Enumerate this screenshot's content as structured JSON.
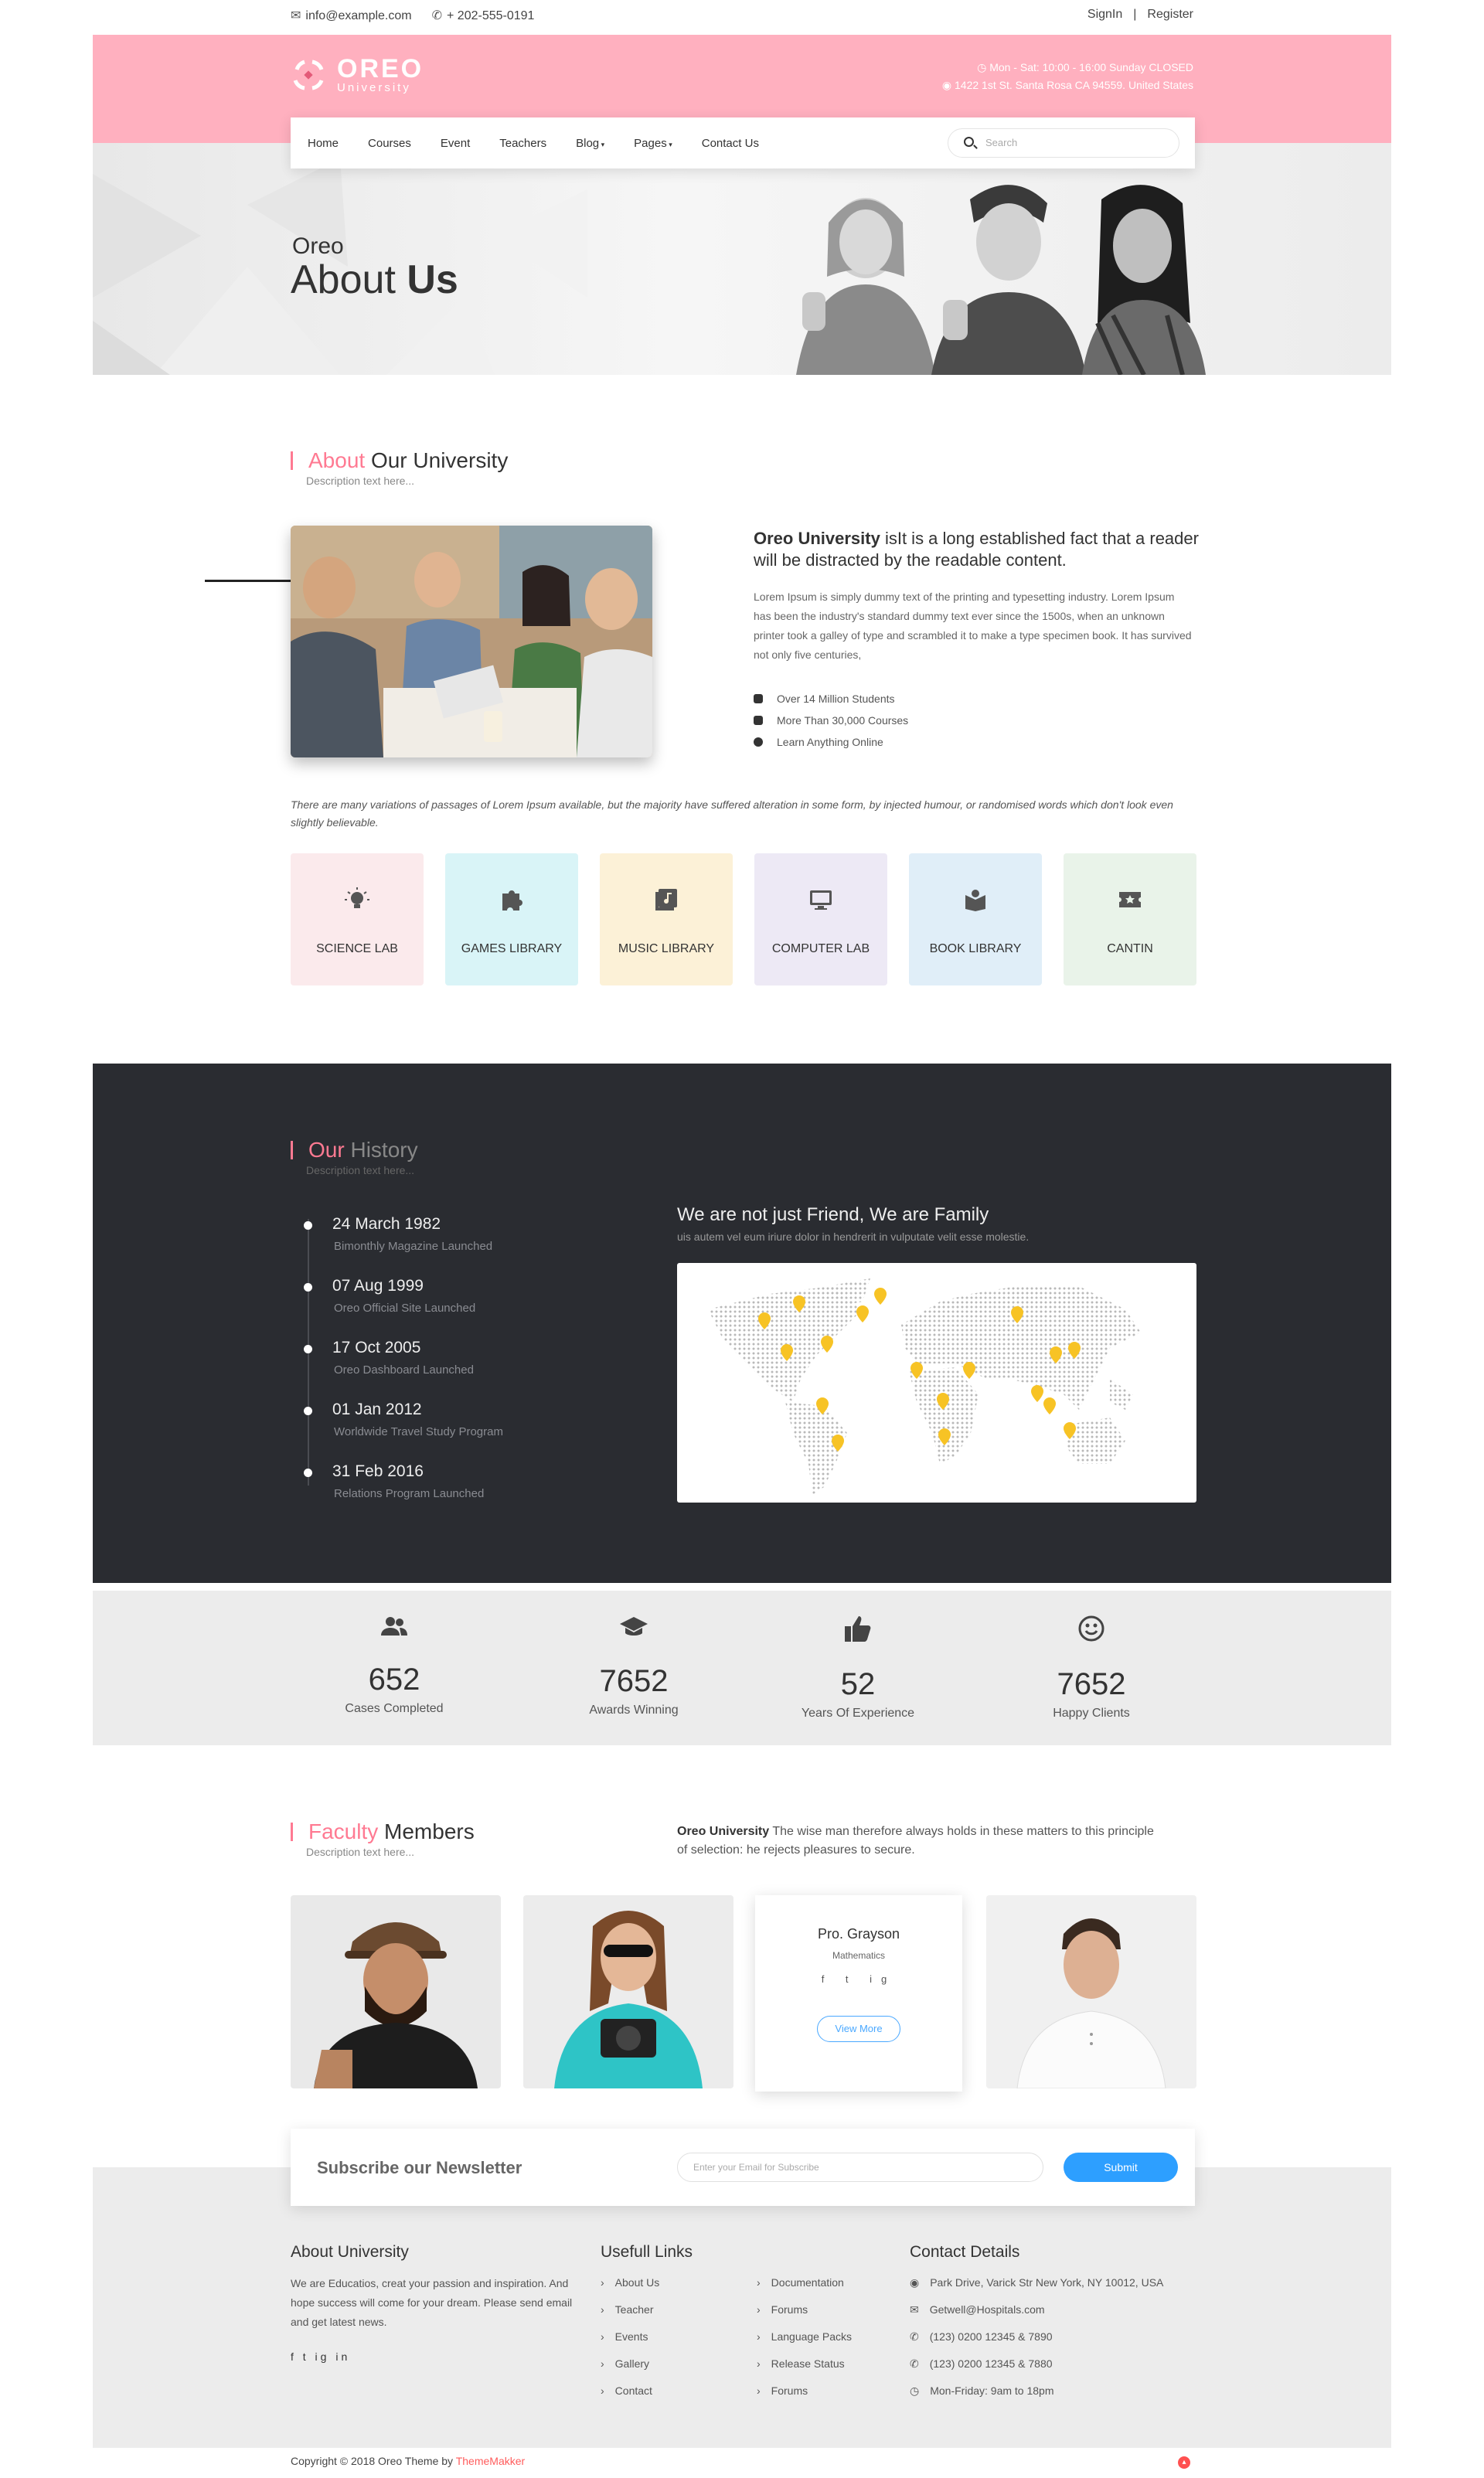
{
  "topbar": {
    "email": "info@example.com",
    "phone": "+ 202-555-0191",
    "signin": "SignIn",
    "separator": "|",
    "register": "Register"
  },
  "brand": {
    "name": "OREO",
    "sub": "University"
  },
  "header_info": {
    "hours": "Mon - Sat: 10:00 - 16:00 Sunday CLOSED",
    "address": "1422 1st St. Santa Rosa CA 94559. United States"
  },
  "nav": {
    "items": [
      "Home",
      "Courses",
      "Event",
      "Teachers",
      "Blog",
      "Pages",
      "Contact Us"
    ],
    "search_placeholder": "Search"
  },
  "hero": {
    "small": "Oreo",
    "big_light": "About ",
    "big_bold": "Us"
  },
  "about": {
    "heading_accent": "About",
    "heading_rest": " Our University",
    "desc": "Description text here...",
    "lead_bold": "Oreo University",
    "lead_rest": " isIt is a long established fact that a reader will  be distracted by the readable content.",
    "para": "Lorem Ipsum is simply dummy text of the printing and typesetting industry. Lorem Ipsum has been the industry's standard dummy text ever since the 1500s, when an unknown printer took a galley of type and scrambled it to make a type specimen book. It has survived not only five centuries,",
    "list": [
      "Over 14 Million Students",
      "More Than 30,000 Courses",
      "Learn Anything Online"
    ],
    "italic": "There are many variations of passages of Lorem Ipsum available, but the majority have suffered alteration in some form, by injected humour, or randomised words which don't look even slightly believable."
  },
  "facilities": [
    {
      "label": "SCIENCE LAB",
      "icon": "bulb-icon",
      "color": "#fbeaec"
    },
    {
      "label": "GAMES LIBRARY",
      "icon": "puzzle-icon",
      "color": "#d9f4f7"
    },
    {
      "label": "MUSIC LIBRARY",
      "icon": "music-icon",
      "color": "#fcf1d7"
    },
    {
      "label": "COMPUTER LAB",
      "icon": "monitor-icon",
      "color": "#ede9f5"
    },
    {
      "label": "BOOK LIBRARY",
      "icon": "book-icon",
      "color": "#e0eef8"
    },
    {
      "label": "CANTIN",
      "icon": "ticket-icon",
      "color": "#e9f3e9"
    }
  ],
  "history": {
    "heading_accent": "Our",
    "heading_rest": " History",
    "desc": "Description text here...",
    "items": [
      {
        "date": "24 March 1982",
        "desc": "Bimonthly Magazine Launched"
      },
      {
        "date": "07 Aug 1999",
        "desc": "Oreo Official Site Launched"
      },
      {
        "date": "17 Oct 2005",
        "desc": "Oreo Dashboard Launched"
      },
      {
        "date": "01 Jan 2012",
        "desc": "Worldwide Travel Study Program"
      },
      {
        "date": "31 Feb 2016",
        "desc": "Relations Program Launched"
      }
    ],
    "family_title": "We are not just Friend, We are Family",
    "family_text": "uis autem vel eum iriure dolor in hendrerit in vulputate velit esse molestie."
  },
  "stats": [
    {
      "num": "652",
      "label": "Cases Completed",
      "icon": "users-icon"
    },
    {
      "num": "7652",
      "label": "Awards Winning",
      "icon": "graduation-cap-icon"
    },
    {
      "num": "52",
      "label": "Years Of Experience",
      "icon": "thumbs-up-icon"
    },
    {
      "num": "7652",
      "label": "Happy Clients",
      "icon": "smile-icon"
    }
  ],
  "faculty": {
    "heading_accent": "Faculty",
    "heading_rest": " Members",
    "desc": "Description text here...",
    "intro_bold": "Oreo University",
    "intro_rest": " The wise man therefore always holds in these matters to this principle of selection: he rejects pleasures to secure.",
    "card": {
      "name": "Pro. Grayson",
      "subject": "Mathematics",
      "social": "f  t  ig",
      "button": "View More"
    }
  },
  "newsletter": {
    "title": "Subscribe our Newsletter",
    "placeholder": "Enter your Email for Subscribe",
    "button": "Submit"
  },
  "footer": {
    "about_title": "About University",
    "about_text": "We are Educatios, creat your passion and inspiration. And hope success will come for your dream. Please send email and get latest news.",
    "social": "f   t   ig   in",
    "links_title": "Usefull Links",
    "links_col1": [
      "About Us",
      "Teacher",
      "Events",
      "Gallery",
      "Contact"
    ],
    "links_col2": [
      "Documentation",
      "Forums",
      "Language Packs",
      "Release Status",
      "Forums"
    ],
    "contact_title": "Contact Details",
    "contacts": [
      "Park Drive, Varick Str New York, NY 10012, USA",
      "Getwell@Hospitals.com",
      "(123) 0200 12345 & 7890",
      "(123) 0200 12345 & 7880",
      "Mon-Friday: 9am to 18pm"
    ]
  },
  "copyright": {
    "text": "Copyright © 2018 Oreo Theme by ",
    "brand": "ThemeMakker"
  },
  "colors": {
    "accent": "#ff7a92",
    "header_pink": "#ffb0bf",
    "dark": "#2a2c31",
    "blue": "#2d9fff",
    "pin": "#f7c325"
  }
}
